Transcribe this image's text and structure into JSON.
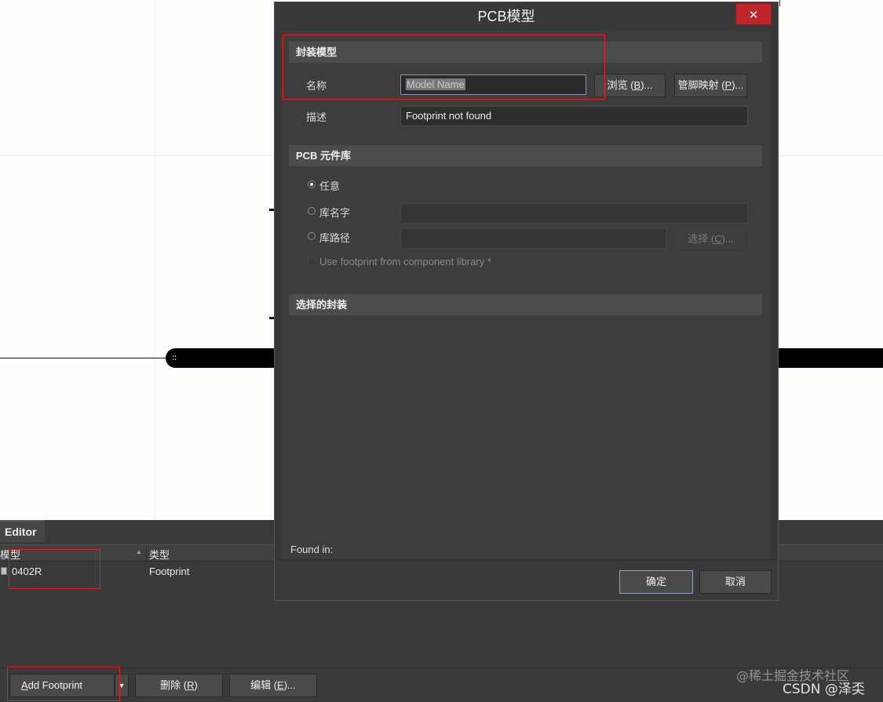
{
  "dialog": {
    "title": "PCB模型",
    "close_glyph": "✕",
    "footprint_section": {
      "header": "封装模型",
      "name_label": "名称",
      "name_value": "Model Name",
      "browse_button": "浏览 (B)...",
      "pinmap_button": "管脚映射 (P)...",
      "desc_label": "描述",
      "desc_value": "Footprint not found"
    },
    "library_section": {
      "header": "PCB 元件库",
      "opt_any": "任意",
      "opt_libname": "库名字",
      "opt_libpath": "库路径",
      "choose_button": "选择 (C)...",
      "use_component_lib": "Use footprint from component library *"
    },
    "selected_section": {
      "header": "选择的封装",
      "found_in_label": "Found in:"
    },
    "ok_button": "确定",
    "cancel_button": "取消"
  },
  "editor_panel": {
    "tab": "Editor",
    "columns": [
      "模型",
      "类型"
    ],
    "rows": [
      {
        "model": "0402R",
        "type": "Footprint"
      }
    ],
    "add_footprint_button": "Add Footprint",
    "delete_button": "删除 (R)",
    "edit_button": "编辑 (E)..."
  },
  "watermark": {
    "line1": "@稀土掘金技术社区",
    "line2": "CSDN @泽奀"
  },
  "colors": {
    "annotation_red": "#e02020",
    "close_red": "#c0252a",
    "dialog_bg": "#3d3d3d"
  }
}
